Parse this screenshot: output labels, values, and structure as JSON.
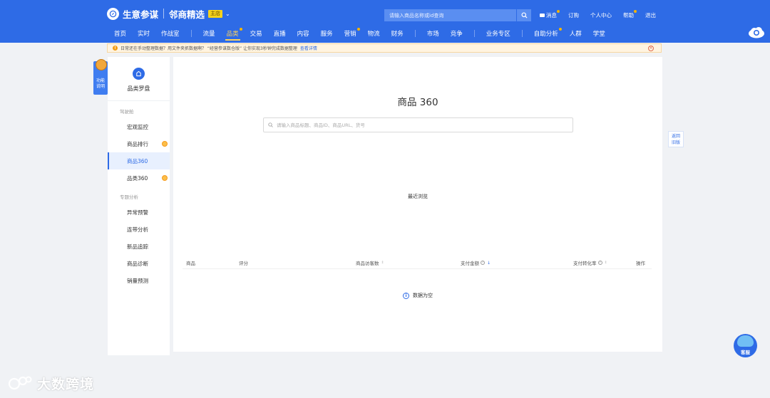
{
  "app": {
    "brand_name": "生意参谋",
    "shop_name": "邻商精选",
    "shop_badge": "主店"
  },
  "search": {
    "placeholder": "请输入商品名称或id查询"
  },
  "user_links": {
    "messages": "消息",
    "subscribe": "订购",
    "personal_center": "个人中心",
    "help": "帮助",
    "logout": "退出"
  },
  "nav": {
    "items": [
      "首页",
      "实时",
      "作战室",
      "流量",
      "品类",
      "交易",
      "直播",
      "内容",
      "服务",
      "营销",
      "物流",
      "财务",
      "市场",
      "竞争",
      "业务专区",
      "自助分析",
      "人群",
      "学堂"
    ],
    "active": "品类"
  },
  "notice": {
    "text": "日常还在手动整理数据？用文件夹抓数据啊？ “经营参谋数仓版” 让你实现3秒钟完成数据整理",
    "link": "查看详情"
  },
  "helper": {
    "label_line1": "功能",
    "label_line2": "说明"
  },
  "sidebar": {
    "title": "品类罗盘",
    "groups": [
      {
        "label": "驾驶舱",
        "items": [
          "宏观监控",
          "商品排行",
          "商品360",
          "品类360"
        ]
      },
      {
        "label": "专题分析",
        "items": [
          "异常预警",
          "连带分析",
          "新品追踪",
          "商品诊断",
          "销量预测"
        ]
      }
    ],
    "active": "商品360"
  },
  "main": {
    "title": "商品 360",
    "search_placeholder": "请输入商品标题、商品ID、商品URL、货号",
    "recent_label": "最近浏览",
    "table_headers": [
      "商品",
      "评分",
      "商品访客数",
      "支付金额",
      "支付转化率",
      "操作"
    ],
    "empty_text": "数据为空"
  },
  "return_old": {
    "line1": "返回",
    "line2": "旧版"
  },
  "customer_service": {
    "label": "客服"
  },
  "watermark": {
    "text": "大数跨境"
  },
  "colors": {
    "brand_blue": "#2e6be6",
    "active_nav": "#fdd15a",
    "notice_bg": "#fff4e0",
    "badge_orange": "#fbbf4a"
  },
  "icons": [
    "compass-icon",
    "search-icon",
    "message-icon",
    "cloud-icon",
    "info-icon",
    "close-icon",
    "shop-icon",
    "service-icon"
  ]
}
